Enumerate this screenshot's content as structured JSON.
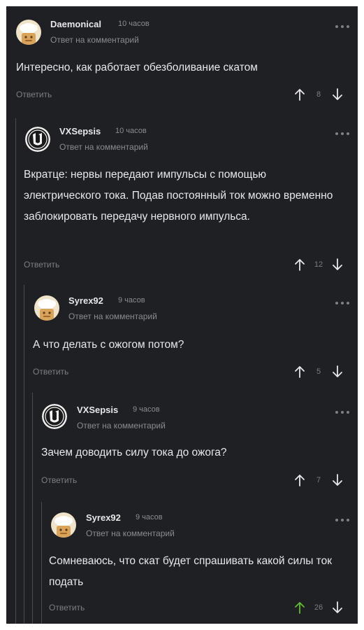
{
  "colors": {
    "background": "#1f2023",
    "text": "#e8e8ec",
    "muted": "#8b8c91",
    "upvote_active": "#5fbd33"
  },
  "comments": [
    {
      "author": "Daemonical",
      "time": "10 часов",
      "reply_to": "Ответ на комментарий",
      "text": "Интересно, как работает обезболивание скатом",
      "reply_label": "Ответить",
      "score": "8",
      "avatar": "chef-avatar-icon",
      "upvoted": false
    },
    {
      "author": "VXSepsis",
      "time": "10 часов",
      "reply_to": "Ответ на комментарий",
      "text": "Вкратце: нервы передают импульсы с помощью электрического тока. Подав постоянный ток можно временно заблокировать передачу нервного импульса.",
      "reply_label": "Ответить",
      "score": "12",
      "avatar": "unreal-logo-avatar-icon",
      "upvoted": false
    },
    {
      "author": "Syrex92",
      "time": "9 часов",
      "reply_to": "Ответ на комментарий",
      "text": "А что делать с ожогом потом?",
      "reply_label": "Ответить",
      "score": "5",
      "avatar": "chef-avatar-icon",
      "upvoted": false
    },
    {
      "author": "VXSepsis",
      "time": "9 часов",
      "reply_to": "Ответ на комментарий",
      "text": "Зачем доводить силу тока до ожога?",
      "reply_label": "Ответить",
      "score": "7",
      "avatar": "unreal-logo-avatar-icon",
      "upvoted": false
    },
    {
      "author": "Syrex92",
      "time": "9 часов",
      "reply_to": "Ответ на комментарий",
      "text": "Сомневаюсь, что скат будет спрашивать какой силы ток подать",
      "reply_label": "Ответить",
      "score": "26",
      "avatar": "chef-avatar-icon",
      "upvoted": true
    }
  ]
}
